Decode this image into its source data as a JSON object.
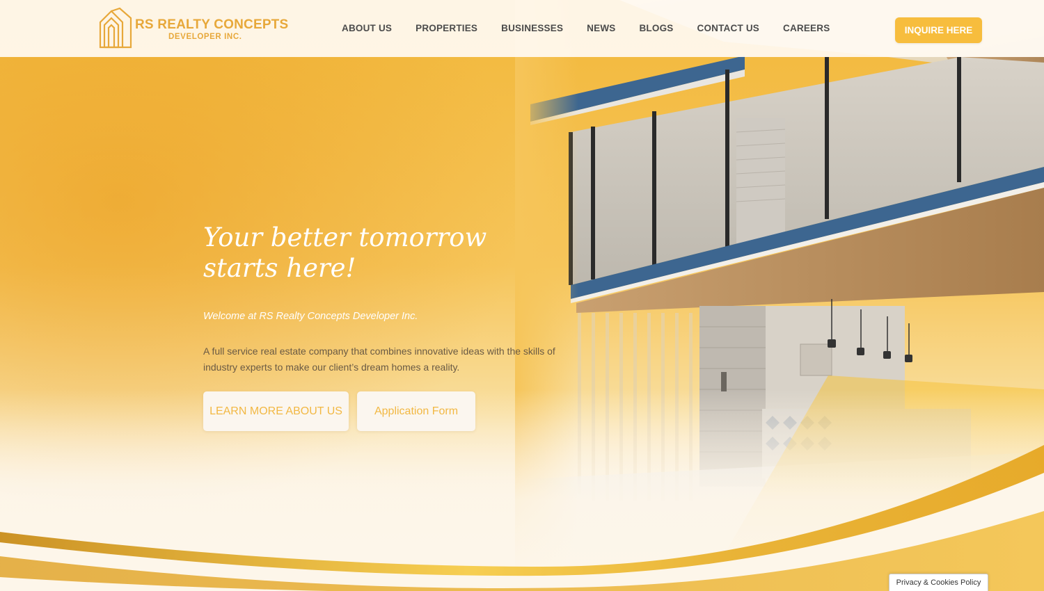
{
  "brand": {
    "name": "RS REALTY CONCEPTS",
    "sub": "DEVELOPER INC.",
    "logo_icon": "house-outline-logo-icon",
    "accent_color": "#f7bd3d",
    "gold_text_color": "#e7a83a"
  },
  "nav": {
    "items": [
      {
        "label": "ABOUT US"
      },
      {
        "label": "PROPERTIES"
      },
      {
        "label": "BUSINESSES"
      },
      {
        "label": "NEWS"
      },
      {
        "label": "BLOGS"
      },
      {
        "label": "CONTACT US"
      },
      {
        "label": "CAREERS"
      }
    ],
    "cta_label": "INQUIRE HERE"
  },
  "hero": {
    "headline_line1": "Your better tomorrow",
    "headline_line2": "starts here!",
    "welcome": "Welcome at RS Realty Concepts Developer Inc.",
    "description": "A full service real estate company that combines innovative ideas with the skills of industry experts to make our client’s dream homes a reality.",
    "learn_more_label": "LEARN MORE ABOUT US",
    "application_label": "Application Form"
  },
  "footer": {
    "privacy_label": "Privacy & Cookies Policy"
  }
}
